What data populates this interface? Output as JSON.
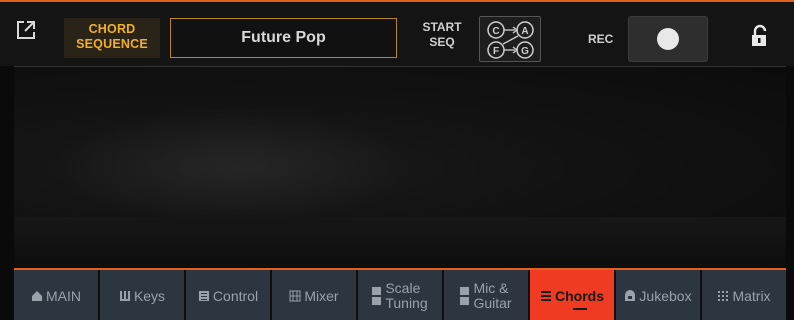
{
  "header": {
    "chord_sequence_label_line1": "CHORD",
    "chord_sequence_label_line2": "SEQUENCE",
    "style_name": "Future Pop",
    "start_seq_line1": "START",
    "start_seq_line2": "SEQ",
    "seq_icon_letters": [
      "C",
      "A",
      "F",
      "G"
    ],
    "rec_label": "REC",
    "icons": {
      "expand": "expand-arrow-icon",
      "lock": "unlocked-padlock-icon"
    }
  },
  "colors": {
    "accent_orange": "#e0621c",
    "chord_sequence_text": "#f0b02c",
    "active_tab": "#ee3b22",
    "tab_bg": "#2d3540"
  },
  "tabs": [
    {
      "label": "MAIN",
      "icon": "home-icon",
      "active": false
    },
    {
      "label": "Keys",
      "icon": "keys-icon",
      "active": false
    },
    {
      "label": "Control",
      "icon": "control-icon",
      "active": false
    },
    {
      "label": "Mixer",
      "icon": "mixer-icon",
      "active": false
    },
    {
      "label_line1": "Scale",
      "label_line2": "Tuning",
      "icon": "scale-icon",
      "active": false
    },
    {
      "label_line1": "Mic &",
      "label_line2": "Guitar",
      "icon": "mic-icon",
      "active": false
    },
    {
      "label": "Chords",
      "icon": "chords-icon",
      "active": true
    },
    {
      "label": "Jukebox",
      "icon": "jukebox-icon",
      "active": false
    },
    {
      "label": "Matrix",
      "icon": "matrix-icon",
      "active": false
    }
  ]
}
